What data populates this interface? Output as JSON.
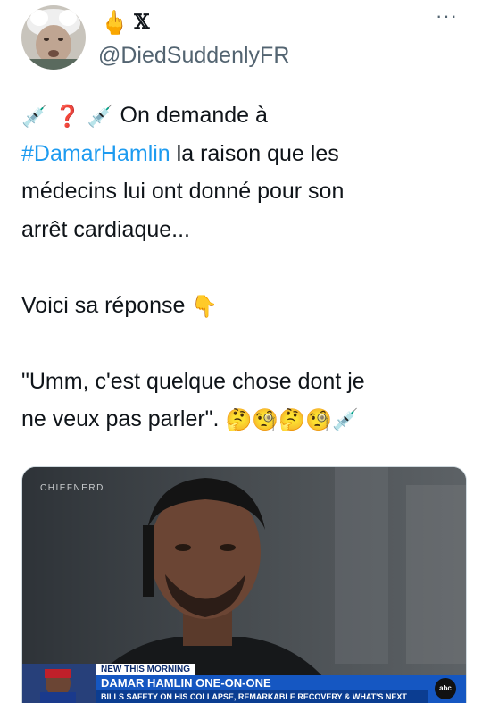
{
  "header": {
    "display_name_emoji": "🖕",
    "display_name_x": "𝕏",
    "handle": "@DiedSuddenlyFR",
    "more_label": "···"
  },
  "tweet": {
    "line1_emojis": [
      "💉",
      "❓",
      "💉"
    ],
    "line1_text": "On demande à",
    "hashtag": "#DamarHamlin",
    "line2_rest": " la raison que les",
    "line3": "médecins lui ont donné pour son",
    "line4": "arrêt cardiaque...",
    "line5_text": "Voici sa réponse",
    "line5_emoji": "👇",
    "line6": "\"Umm, c'est quelque chose dont je",
    "line7_text": "ne veux pas parler\".",
    "line7_emojis": [
      "🤔",
      "🧐",
      "🤔",
      "🧐",
      "💉"
    ]
  },
  "media": {
    "watermark": "CHIEFNERD",
    "lower_third": {
      "tag": "NEW THIS MORNING",
      "title": "DAMAR HAMLIN ONE-ON-ONE",
      "subtitle": "BILLS SAFETY ON HIS COLLAPSE, REMARKABLE RECOVERY & WHAT'S NEXT",
      "network": "abc"
    }
  },
  "colors": {
    "hashtag": "#1d9bf0",
    "handle": "#536471",
    "lower_third_blue": "#1557c2",
    "lower_third_dark": "#0b3d91"
  }
}
